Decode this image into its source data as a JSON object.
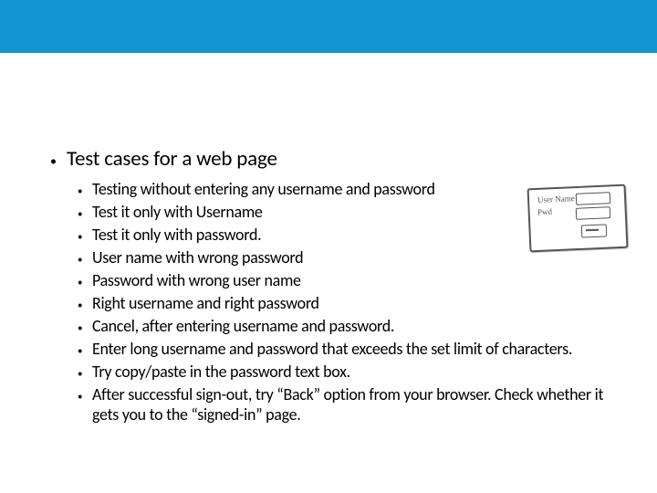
{
  "slide": {
    "heading": "Test cases for a web page",
    "bullets": [
      "Testing without entering any username and password",
      "Test it only with Username",
      "Test it only with password.",
      "User name with wrong password",
      "Password with wrong user name",
      "Right username and right password",
      "Cancel, after entering username and password.",
      "Enter long username and password that exceeds the set limit of characters.",
      "Try copy/paste in the password text box.",
      "After successful sign-out, try “Back” option from your browser. Check whether it gets you to the “signed-in” page."
    ],
    "sketch_labels": {
      "user": "User Name",
      "pwd": "Pwd",
      "ok": ""
    }
  }
}
